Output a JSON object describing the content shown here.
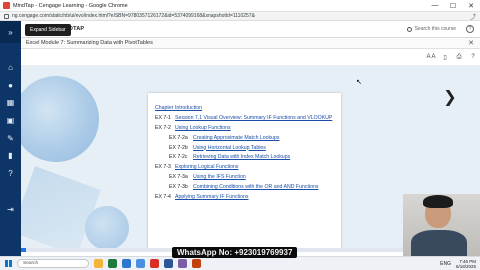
{
  "window": {
    "title": "MindTap - Cengage Learning - Google Chrome",
    "controls": [
      "—",
      "☐",
      "✕"
    ]
  },
  "address": {
    "url": "ng.cengage.com/static/nb/ui/evo/index.html?eISBN=9780357126172&id=5374099168&snapshotId=1110257&"
  },
  "sidebar": {
    "tooltip": "Expand Sidebar",
    "items": [
      "»",
      "⌂",
      "●",
      "▦",
      "▣",
      "✎",
      "▮",
      "?",
      "⇥"
    ]
  },
  "coursebar": {
    "course_title": "INDTAP",
    "search_label": "Search this course",
    "help_label": "?"
  },
  "module": {
    "title": "Excel Module 7: Summarizing Data with PivotTables",
    "close_label": "✕"
  },
  "reader_tools": [
    "A A",
    "▯",
    "⎙",
    "?"
  ],
  "toc": [
    {
      "num": "",
      "sub": "",
      "text": "Chapter Introduction",
      "level": 1
    },
    {
      "num": "EX 7-1",
      "sub": "",
      "text": "Session 7.1 Visual Overview: Summary IF Functions and VLOOKUP",
      "level": 1
    },
    {
      "num": "EX 7-2",
      "sub": "",
      "text": "Using Lookup Functions",
      "level": 1
    },
    {
      "num": "EX 7-2a",
      "sub": "",
      "text": "Creating Approximate Match Lookups",
      "level": 2
    },
    {
      "num": "EX 7-2b",
      "sub": "",
      "text": "Using Horizontal Lookup Tables",
      "level": 2
    },
    {
      "num": "EX 7-2c",
      "sub": "",
      "text": "Retrieving Data with Index Match Lookups",
      "level": 2
    },
    {
      "num": "EX 7-3",
      "sub": "",
      "text": "Exploring Logical Functions",
      "level": 1
    },
    {
      "num": "EX 7-3a",
      "sub": "",
      "text": "Using the IFS Function",
      "level": 2
    },
    {
      "num": "EX 7-3b",
      "sub": "",
      "text": "Combining Conditions with the OR and AND Functions",
      "level": 2
    },
    {
      "num": "EX 7-4",
      "sub": "",
      "text": "Applying Summary IF Functions",
      "level": 1
    }
  ],
  "next_arrow": "❯",
  "progress_fraction": 0.01,
  "taskbar": {
    "search_placeholder": "Search",
    "time": "7:46 PM",
    "date": "6/18/2025",
    "tray": "ENG"
  },
  "watermark": "WhatsApp No: +923019769937",
  "colors": {
    "sidebar_bg": "#0d3567",
    "link": "#1a4fa8",
    "content_bg": "#e6eef6",
    "progress": "#1a73e8"
  }
}
